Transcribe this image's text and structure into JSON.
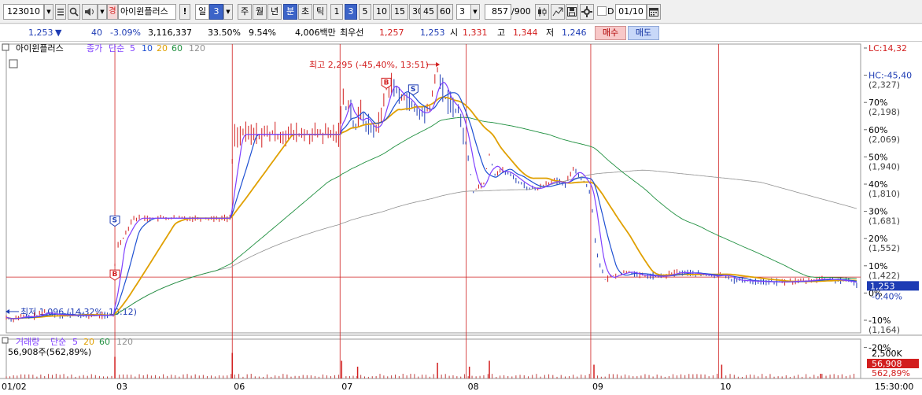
{
  "toolbar": {
    "code": "123010",
    "flag_badge": "경",
    "stock_name": "아이윈플러스",
    "warn": "!",
    "period_label": "일",
    "period_num": "3",
    "tabs": [
      "주",
      "월",
      "년",
      "분",
      "초",
      "틱"
    ],
    "active_tab": "분",
    "intervals": [
      "1",
      "3",
      "5",
      "10",
      "15",
      "30",
      "45",
      "60"
    ],
    "active_interval": "3",
    "count": "3",
    "range": "857",
    "range_total": "/900",
    "d_label": "D",
    "date": "01/10"
  },
  "quote": {
    "price": "1,253",
    "arrow": "▼",
    "change": "40",
    "change_pct": "-3.09%",
    "volume": "3,116,337",
    "vol_pct": "33.50%",
    "turnover": "9.54%",
    "amount": "4,006백만",
    "best_label": "최우선",
    "ask": "1,257",
    "bid": "1,253",
    "open_label": "시",
    "open": "1,331",
    "high_label": "고",
    "high": "1,344",
    "low_label": "저",
    "low": "1,246",
    "buy_btn": "매수",
    "sell_btn": "매도"
  },
  "chart_data": {
    "type": "candlestick",
    "title": "아이윈플러스",
    "legend": {
      "price_label": "종가",
      "ma_label": "단순",
      "ma_periods": [
        "5",
        "10",
        "20",
        "60",
        "120"
      ],
      "volume_label": "거래량",
      "volume_ma_label": "단순",
      "volume_ma_periods": [
        "5",
        "20",
        "60",
        "120"
      ],
      "volume_value": "56,908주(562,89%)"
    },
    "colors": {
      "ma5": "#8040ff",
      "ma10": "#1e50d2",
      "ma20": "#e0a000",
      "ma60": "#209040",
      "ma120": "#909090",
      "up": "#d21e1e",
      "down": "#1e3cb4"
    },
    "x_labels": [
      "01/02",
      "03",
      "06",
      "07",
      "08",
      "09",
      "10"
    ],
    "time_label": "15:30:00",
    "right_axis": [
      {
        "pct": "LC:14,32",
        "price": ""
      },
      {
        "pct": "HC:-45,40",
        "price": "(2,327)"
      },
      {
        "pct": "70%",
        "price": "(2,198)"
      },
      {
        "pct": "60%",
        "price": "(2,069)"
      },
      {
        "pct": "50%",
        "price": "(1,940)"
      },
      {
        "pct": "40%",
        "price": "(1,810)"
      },
      {
        "pct": "30%",
        "price": "(1,681)"
      },
      {
        "pct": "20%",
        "price": "(1,552)"
      },
      {
        "pct": "10%",
        "price": "(1,422)"
      },
      {
        "pct": "0%",
        "price": ""
      },
      {
        "pct": "-10%",
        "price": "(1,164)"
      },
      {
        "pct": "-20%",
        "price": ""
      }
    ],
    "price_ylim": [
      1040,
      2350
    ],
    "current_price": 1253,
    "current_price_label": "1,253",
    "current_pct_label": "-0.40%",
    "reference_price": 1293,
    "high_annotation": "최고 2,295 (-45,40%, 13:51)",
    "low_annotation": "최저 1,096 (14,32%, 10:12)",
    "volume_axis": [
      "2,500K"
    ],
    "volume_current_label": "56,908",
    "volume_pct_label": "562,89%",
    "markers": [
      {
        "label": "S"
      },
      {
        "label": "B"
      },
      {
        "label": "B"
      },
      {
        "label": "S"
      }
    ],
    "close_path": [
      [
        0,
        1110
      ],
      [
        0.006,
        1100
      ],
      [
        0.012,
        1108
      ],
      [
        0.02,
        1115
      ],
      [
        0.03,
        1112
      ],
      [
        0.04,
        1120
      ],
      [
        0.048,
        1135
      ],
      [
        0.056,
        1125
      ],
      [
        0.064,
        1122
      ],
      [
        0.08,
        1120
      ],
      [
        0.1,
        1118
      ],
      [
        0.12,
        1120
      ],
      [
        0.13,
        1118
      ],
      [
        0.134,
        1120
      ],
      [
        0.136,
        1350
      ],
      [
        0.14,
        1440
      ],
      [
        0.148,
        1480
      ],
      [
        0.158,
        1560
      ],
      [
        0.17,
        1560
      ],
      [
        0.2,
        1560
      ],
      [
        0.24,
        1560
      ],
      [
        0.28,
        1560
      ],
      [
        0.283,
        1820
      ],
      [
        0.286,
        1940
      ],
      [
        0.3,
        1940
      ],
      [
        0.34,
        1940
      ],
      [
        0.38,
        1940
      ],
      [
        0.418,
        1940
      ],
      [
        0.42,
        2150
      ],
      [
        0.424,
        2050
      ],
      [
        0.43,
        2100
      ],
      [
        0.436,
        1950
      ],
      [
        0.444,
        2050
      ],
      [
        0.452,
        1980
      ],
      [
        0.46,
        1960
      ],
      [
        0.468,
        2000
      ],
      [
        0.476,
        2150
      ],
      [
        0.484,
        2180
      ],
      [
        0.492,
        2100
      ],
      [
        0.5,
        2120
      ],
      [
        0.508,
        2060
      ],
      [
        0.516,
        2040
      ],
      [
        0.524,
        2030
      ],
      [
        0.532,
        2080
      ],
      [
        0.54,
        2240
      ],
      [
        0.545,
        2160
      ],
      [
        0.55,
        2100
      ],
      [
        0.558,
        2080
      ],
      [
        0.566,
        2040
      ],
      [
        0.574,
        1930
      ],
      [
        0.58,
        1800
      ],
      [
        0.585,
        1680
      ],
      [
        0.59,
        1700
      ],
      [
        0.598,
        1720
      ],
      [
        0.605,
        1850
      ],
      [
        0.612,
        1760
      ],
      [
        0.62,
        1780
      ],
      [
        0.63,
        1760
      ],
      [
        0.64,
        1730
      ],
      [
        0.652,
        1700
      ],
      [
        0.664,
        1690
      ],
      [
        0.676,
        1720
      ],
      [
        0.688,
        1730
      ],
      [
        0.7,
        1710
      ],
      [
        0.71,
        1790
      ],
      [
        0.72,
        1740
      ],
      [
        0.732,
        1680
      ],
      [
        0.736,
        1500
      ],
      [
        0.742,
        1360
      ],
      [
        0.75,
        1280
      ],
      [
        0.76,
        1300
      ],
      [
        0.77,
        1310
      ],
      [
        0.78,
        1320
      ],
      [
        0.79,
        1300
      ],
      [
        0.8,
        1300
      ],
      [
        0.82,
        1295
      ],
      [
        0.84,
        1315
      ],
      [
        0.86,
        1310
      ],
      [
        0.88,
        1300
      ],
      [
        0.892,
        1295
      ],
      [
        0.896,
        1310
      ],
      [
        0.91,
        1280
      ],
      [
        0.93,
        1275
      ],
      [
        0.95,
        1272
      ],
      [
        0.97,
        1270
      ],
      [
        0.99,
        1275
      ],
      [
        1.0,
        1275
      ],
      [
        1.02,
        1285
      ],
      [
        1.04,
        1280
      ],
      [
        1.06,
        1270
      ],
      [
        1.065,
        1260
      ]
    ],
    "volume_spikes": [
      {
        "x": 0.136,
        "v": 0.55
      },
      {
        "x": 0.283,
        "v": 0.65
      },
      {
        "x": 0.42,
        "v": 0.45
      },
      {
        "x": 0.44,
        "v": 0.3
      },
      {
        "x": 0.54,
        "v": 0.4
      },
      {
        "x": 0.58,
        "v": 0.3
      },
      {
        "x": 0.605,
        "v": 0.45
      },
      {
        "x": 0.736,
        "v": 0.35
      },
      {
        "x": 0.896,
        "v": 0.35
      },
      {
        "x": 1.02,
        "v": 0.12
      }
    ]
  }
}
